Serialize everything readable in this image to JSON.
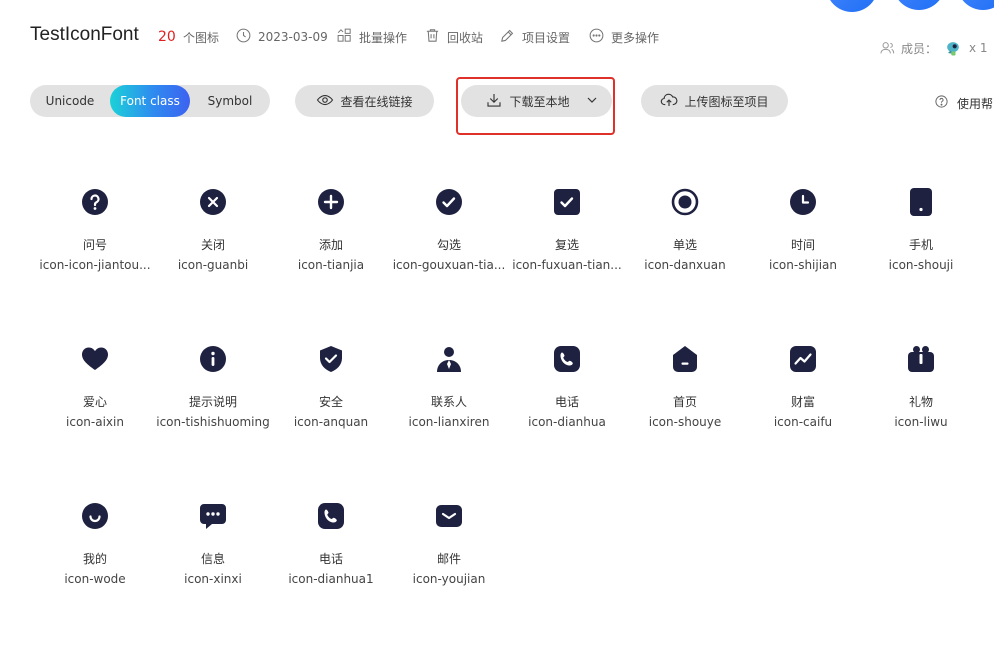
{
  "header": {
    "project_name": "TestIconFont",
    "icon_count": "20",
    "icon_count_unit": "个图标",
    "date": "2023-03-09",
    "batch_label": "批量操作",
    "trash_label": "回收站",
    "settings_label": "项目设置",
    "more_label": "更多操作",
    "members_label": "成员：",
    "members_count": "x 1"
  },
  "toolbar": {
    "tabs": [
      {
        "label": "Unicode",
        "active": false
      },
      {
        "label": "Font class",
        "active": true
      },
      {
        "label": "Symbol",
        "active": false
      }
    ],
    "view_link_label": "查看在线链接",
    "download_label": "下载至本地",
    "upload_label": "上传图标至项目",
    "help_label": "使用帮"
  },
  "colors": {
    "icon_fill": "#1e2140",
    "accent_gradient_start": "#1bd1d8",
    "accent_gradient_end": "#3c62f0",
    "count_red": "#e02020",
    "highlight_border": "#e0302a"
  },
  "icons": [
    {
      "name": "问号",
      "class": "icon-icon-jiantou...",
      "icon": "question-icon"
    },
    {
      "name": "关闭",
      "class": "icon-guanbi",
      "icon": "close-circle-icon"
    },
    {
      "name": "添加",
      "class": "icon-tianjia",
      "icon": "plus-circle-icon"
    },
    {
      "name": "勾选",
      "class": "icon-gouxuan-tia...",
      "icon": "check-circle-icon"
    },
    {
      "name": "复选",
      "class": "icon-fuxuan-tian...",
      "icon": "checkbox-icon"
    },
    {
      "name": "单选",
      "class": "icon-danxuan",
      "icon": "radio-icon"
    },
    {
      "name": "时间",
      "class": "icon-shijian",
      "icon": "clock-icon"
    },
    {
      "name": "手机",
      "class": "icon-shouji",
      "icon": "phone-device-icon"
    },
    {
      "name": "爱心",
      "class": "icon-aixin",
      "icon": "heart-icon"
    },
    {
      "name": "提示说明",
      "class": "icon-tishishuoming",
      "icon": "info-icon"
    },
    {
      "name": "安全",
      "class": "icon-anquan",
      "icon": "shield-check-icon"
    },
    {
      "name": "联系人",
      "class": "icon-lianxiren",
      "icon": "contact-person-icon"
    },
    {
      "name": "电话",
      "class": "icon-dianhua",
      "icon": "telephone-icon"
    },
    {
      "name": "首页",
      "class": "icon-shouye",
      "icon": "home-icon"
    },
    {
      "name": "财富",
      "class": "icon-caifu",
      "icon": "wealth-chart-icon"
    },
    {
      "name": "礼物",
      "class": "icon-liwu",
      "icon": "gift-icon"
    },
    {
      "name": "我的",
      "class": "icon-wode",
      "icon": "smile-user-icon"
    },
    {
      "name": "信息",
      "class": "icon-xinxi",
      "icon": "message-icon"
    },
    {
      "name": "电话",
      "class": "icon-dianhua1",
      "icon": "telephone-alt-icon"
    },
    {
      "name": "邮件",
      "class": "icon-youjian",
      "icon": "mail-icon"
    }
  ]
}
